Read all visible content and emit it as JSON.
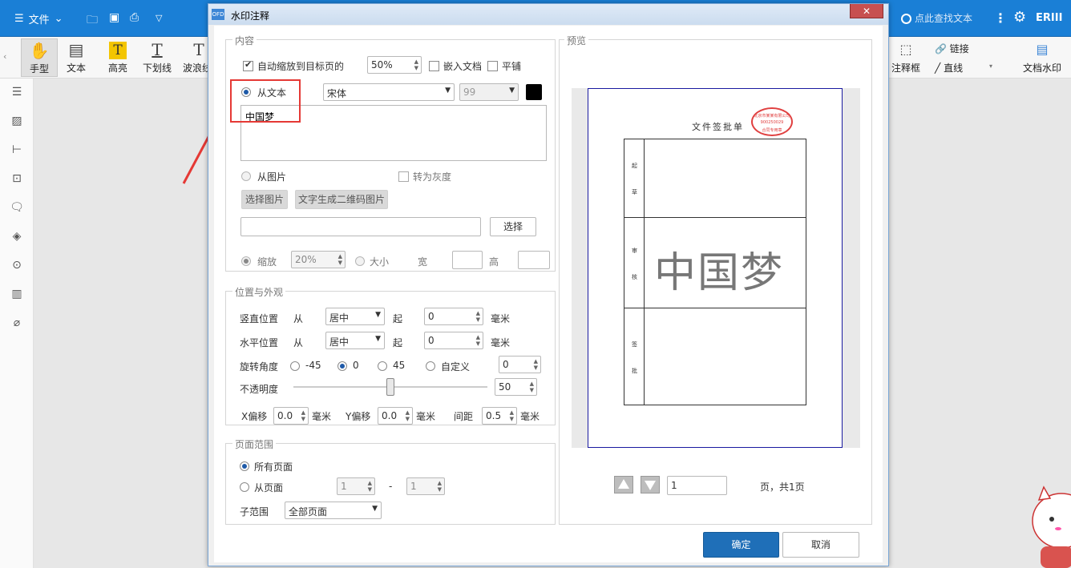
{
  "app": {
    "menu_label": "文件",
    "search_placeholder": "点此查找文本",
    "user_label": "ERIII"
  },
  "ribbon": {
    "hand": "手型",
    "text": "文本",
    "highlight": "高亮",
    "underline": "下划线",
    "wavy": "波浪线",
    "annotation_box": "注释框",
    "link": "链接",
    "line": "直线",
    "doc_watermark": "文档水印"
  },
  "dialog": {
    "title": "水印注释",
    "close": "✕",
    "content": {
      "legend": "内容",
      "auto_scale_label": "自动缩放到目标页的",
      "auto_scale_value": "50%",
      "embed_doc": "嵌入文档",
      "tile": "平铺",
      "from_text": "从文本",
      "font": "宋体",
      "font_size": "99",
      "text_value": "中国梦",
      "from_image": "从图片",
      "to_gray": "转为灰度",
      "choose_image": "选择图片",
      "gen_qr": "文字生成二维码图片",
      "choose": "选择",
      "scale": "缩放",
      "scale_value": "20%",
      "size": "大小",
      "width": "宽",
      "height": "高"
    },
    "position": {
      "legend": "位置与外观",
      "vertical": "竖直位置",
      "horizontal": "水平位置",
      "from": "从",
      "v_align": "居中",
      "h_align": "居中",
      "start": "起",
      "v_offset": "0",
      "h_offset": "0",
      "unit_mm": "毫米",
      "rotation": "旋转角度",
      "rot_m45": "-45",
      "rot_0": "0",
      "rot_45": "45",
      "rot_custom": "自定义",
      "rot_custom_value": "0",
      "opacity": "不透明度",
      "opacity_value": "50",
      "opacity_level": 0.5,
      "x_offset": "X偏移",
      "x_offset_value": "0.0",
      "y_offset": "Y偏移",
      "y_offset_value": "0.0",
      "spacing": "间距",
      "spacing_value": "0.5"
    },
    "pages": {
      "legend": "页面范围",
      "all_pages": "所有页面",
      "from_page": "从页面",
      "page_start": "1",
      "dash": "-",
      "page_end": "1",
      "subrange": "子范围",
      "subrange_value": "全部页面"
    },
    "preview": {
      "legend": "预览",
      "doc_title": "文件签批单",
      "row1": [
        "起",
        "草"
      ],
      "row2": [
        "审",
        "核"
      ],
      "row3": [
        "签",
        "批"
      ],
      "watermark": "中国梦",
      "stamp_top": "北京市某某有限公司",
      "stamp_mid": "900250029",
      "stamp_bottom": "合同专用章",
      "page_value": "1",
      "page_total": "页，共1页"
    },
    "ok": "确定",
    "cancel": "取消"
  },
  "colors": {
    "app_blue": "#1a7fd6",
    "primary_button": "#1f6fb8",
    "highlight_box": "#e53935",
    "stamp_red": "#e04040"
  }
}
